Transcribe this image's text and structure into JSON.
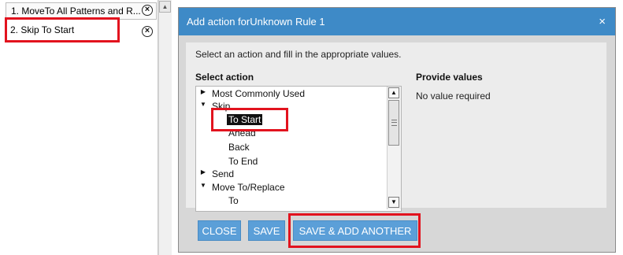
{
  "rules": {
    "items": [
      {
        "label": "1. MoveTo All Patterns and R..."
      },
      {
        "label": "2. Skip To Start"
      }
    ]
  },
  "dialog": {
    "title": "Add action forUnknown Rule 1",
    "close_glyph": "×",
    "instruction": "Select an action and fill in the appropriate values.",
    "select_heading": "Select action",
    "provide_heading": "Provide values",
    "provide_value": "No value required",
    "tree": [
      {
        "label": "Most Commonly Used",
        "level": 0,
        "arrow": "collapsed"
      },
      {
        "label": "Skip",
        "level": 0,
        "arrow": "expanded"
      },
      {
        "label": "To Start",
        "level": 1,
        "selected": true
      },
      {
        "label": "Ahead",
        "level": 1
      },
      {
        "label": "Back",
        "level": 1
      },
      {
        "label": "To End",
        "level": 1
      },
      {
        "label": "Send",
        "level": 0,
        "arrow": "collapsed"
      },
      {
        "label": "Move To/Replace",
        "level": 0,
        "arrow": "expanded"
      },
      {
        "label": "To",
        "level": 1
      }
    ],
    "buttons": {
      "close": "CLOSE",
      "save": "SAVE",
      "save_add": "SAVE & ADD ANOTHER"
    }
  },
  "colors": {
    "title_bar": "#3e8ac7",
    "button": "#5b9fd8",
    "highlight": "#e2131e"
  }
}
